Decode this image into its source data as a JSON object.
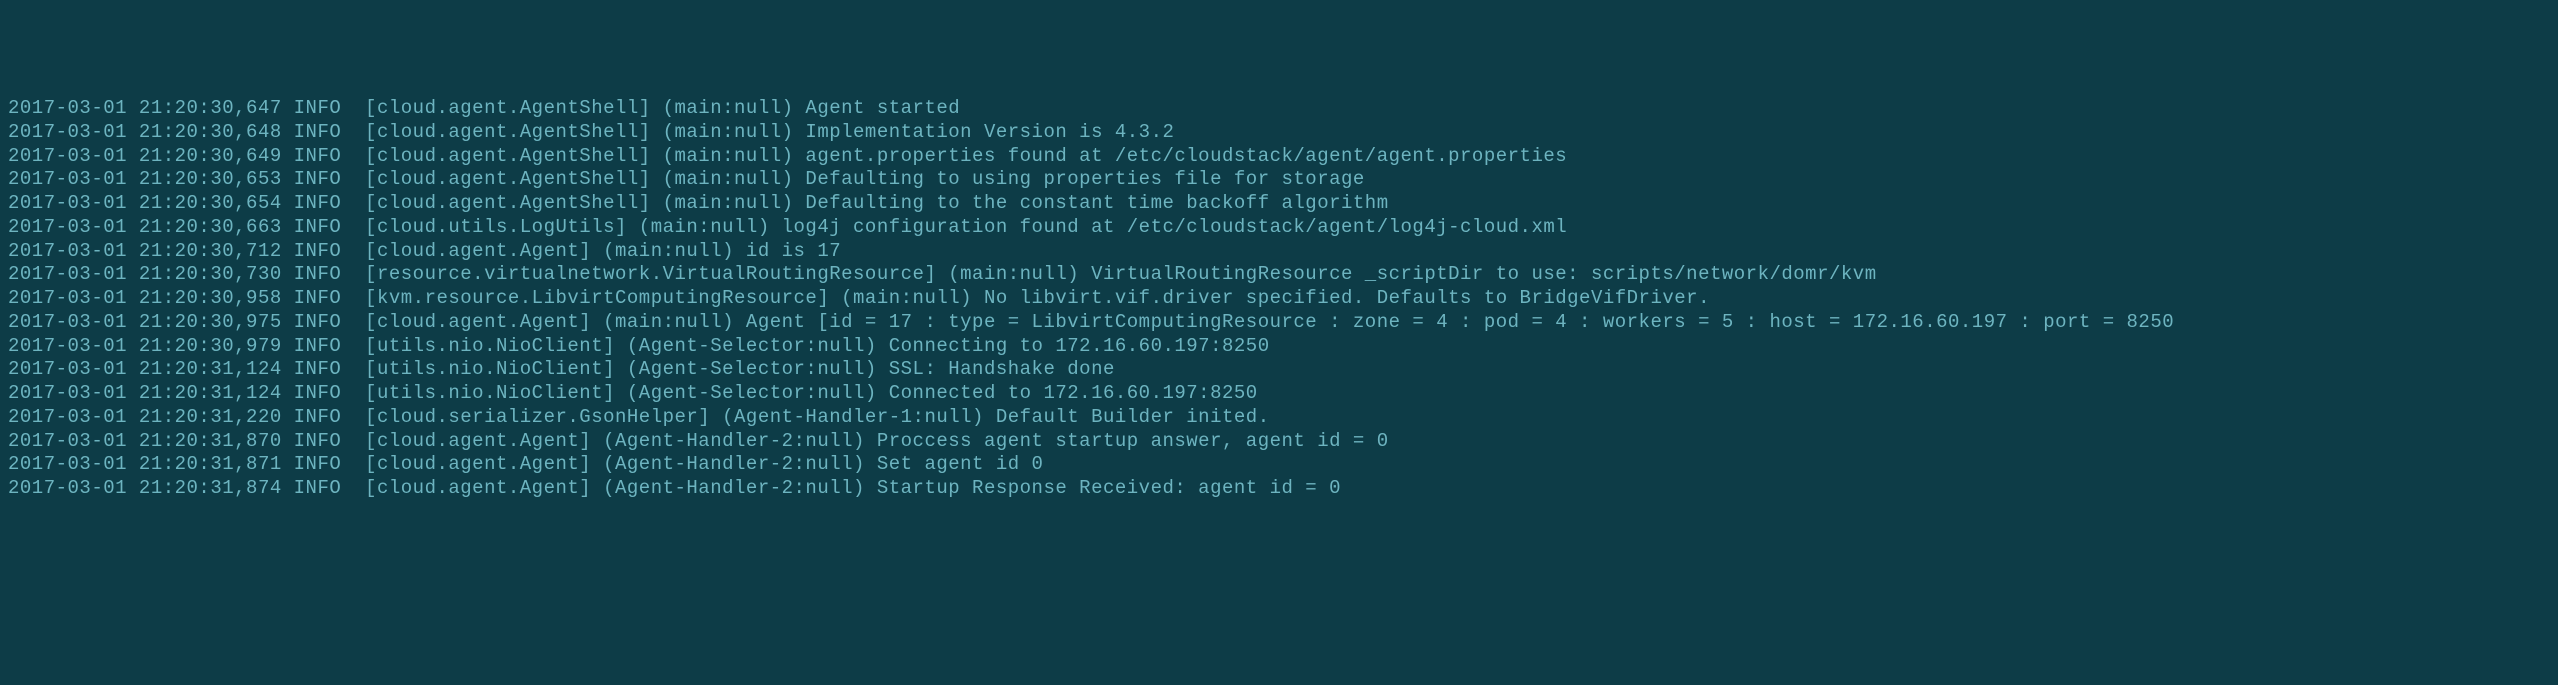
{
  "log": {
    "lines": [
      "2017-03-01 21:20:30,647 INFO  [cloud.agent.AgentShell] (main:null) Agent started",
      "2017-03-01 21:20:30,648 INFO  [cloud.agent.AgentShell] (main:null) Implementation Version is 4.3.2",
      "2017-03-01 21:20:30,649 INFO  [cloud.agent.AgentShell] (main:null) agent.properties found at /etc/cloudstack/agent/agent.properties",
      "2017-03-01 21:20:30,653 INFO  [cloud.agent.AgentShell] (main:null) Defaulting to using properties file for storage",
      "2017-03-01 21:20:30,654 INFO  [cloud.agent.AgentShell] (main:null) Defaulting to the constant time backoff algorithm",
      "2017-03-01 21:20:30,663 INFO  [cloud.utils.LogUtils] (main:null) log4j configuration found at /etc/cloudstack/agent/log4j-cloud.xml",
      "2017-03-01 21:20:30,712 INFO  [cloud.agent.Agent] (main:null) id is 17",
      "2017-03-01 21:20:30,730 INFO  [resource.virtualnetwork.VirtualRoutingResource] (main:null) VirtualRoutingResource _scriptDir to use: scripts/network/domr/kvm",
      "2017-03-01 21:20:30,958 INFO  [kvm.resource.LibvirtComputingResource] (main:null) No libvirt.vif.driver specified. Defaults to BridgeVifDriver.",
      "2017-03-01 21:20:30,975 INFO  [cloud.agent.Agent] (main:null) Agent [id = 17 : type = LibvirtComputingResource : zone = 4 : pod = 4 : workers = 5 : host = 172.16.60.197 : port = 8250",
      "2017-03-01 21:20:30,979 INFO  [utils.nio.NioClient] (Agent-Selector:null) Connecting to 172.16.60.197:8250",
      "2017-03-01 21:20:31,124 INFO  [utils.nio.NioClient] (Agent-Selector:null) SSL: Handshake done",
      "2017-03-01 21:20:31,124 INFO  [utils.nio.NioClient] (Agent-Selector:null) Connected to 172.16.60.197:8250",
      "2017-03-01 21:20:31,220 INFO  [cloud.serializer.GsonHelper] (Agent-Handler-1:null) Default Builder inited.",
      "2017-03-01 21:20:31,870 INFO  [cloud.agent.Agent] (Agent-Handler-2:null) Proccess agent startup answer, agent id = 0",
      "2017-03-01 21:20:31,871 INFO  [cloud.agent.Agent] (Agent-Handler-2:null) Set agent id 0",
      "2017-03-01 21:20:31,874 INFO  [cloud.agent.Agent] (Agent-Handler-2:null) Startup Response Received: agent id = 0"
    ]
  }
}
